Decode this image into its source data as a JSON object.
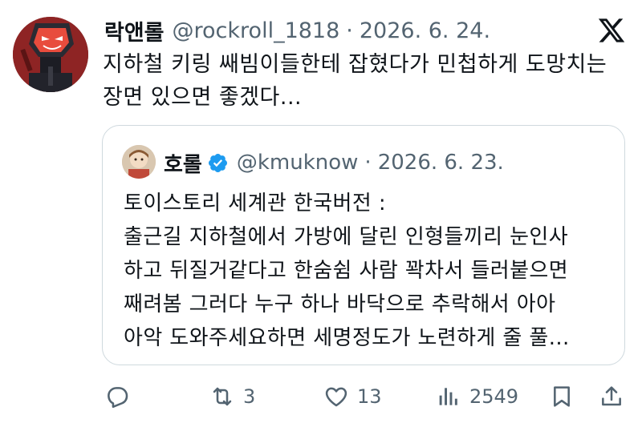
{
  "tweet": {
    "display_name": "락앤롤",
    "handle": "@rockroll_1818",
    "separator": "·",
    "date": "2026. 6. 24.",
    "text": "지하철 키링 쌔빔이들한테 잡혔다가 민첩하게 도망치는 장면 있으면 좋겠다..."
  },
  "quote": {
    "display_name": "호롤",
    "handle": "@kmuknow",
    "separator": "·",
    "date": "2026. 6. 23.",
    "text_lines": [
      "토이스토리 세계관 한국버전 :",
      "출근길 지하철에서 가방에 달린 인형들끼리 눈인사",
      "하고 뒤질거같다고 한숨쉼 사람 꽉차서 들러붙으면",
      "째려봄 그러다 누구 하나 바닥으로 추락해서 아아",
      "아악 도와주세요하면 세명정도가 노련하게 줄 풀..."
    ]
  },
  "actions": {
    "reply": {
      "icon": "reply-icon"
    },
    "retweet": {
      "icon": "retweet-icon",
      "count": "3"
    },
    "like": {
      "icon": "heart-icon",
      "count": "13"
    },
    "views": {
      "icon": "views-icon",
      "count": "2549"
    },
    "bookmark": {
      "icon": "bookmark-icon"
    },
    "share": {
      "icon": "share-icon"
    }
  },
  "colors": {
    "text": "#0f1419",
    "secondary": "#536471",
    "border": "#cfd9de",
    "verified": "#1d9bf0"
  }
}
